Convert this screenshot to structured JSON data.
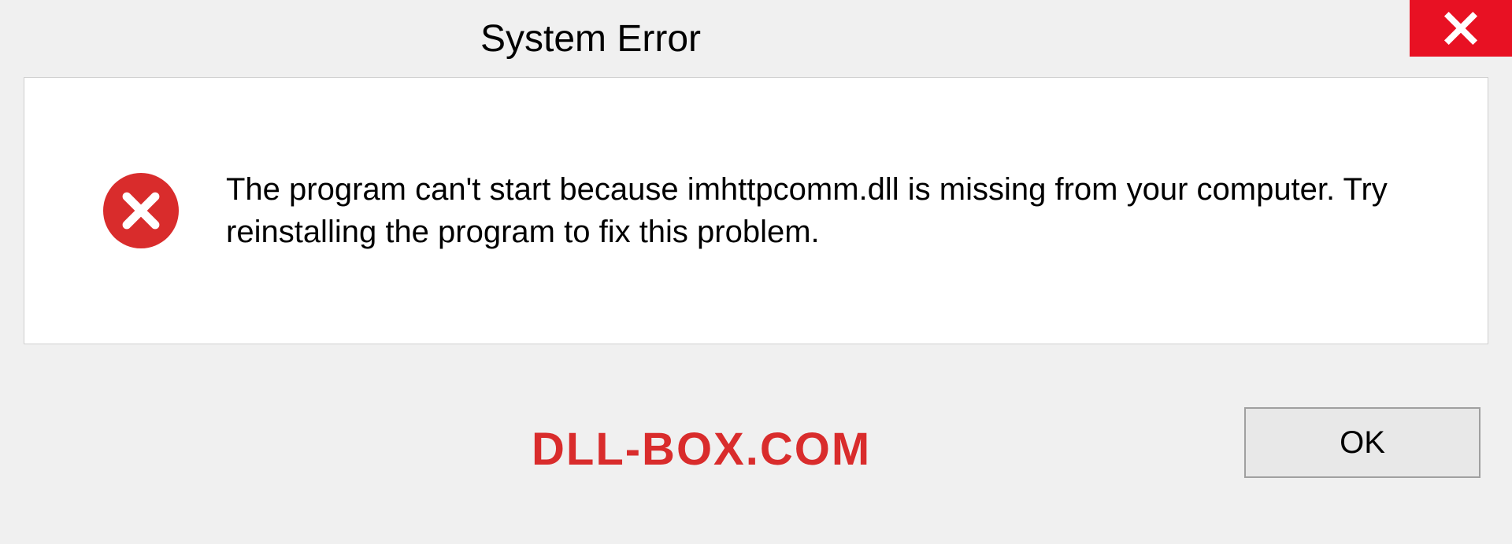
{
  "dialog": {
    "title": "System Error",
    "message": "The program can't start because imhttpcomm.dll is missing from your computer. Try reinstalling the program to fix this problem.",
    "ok_label": "OK"
  },
  "watermark": "DLL-BOX.COM",
  "colors": {
    "close_bg": "#e81123",
    "error_bg": "#d92c2c",
    "watermark": "#d92c2c"
  }
}
